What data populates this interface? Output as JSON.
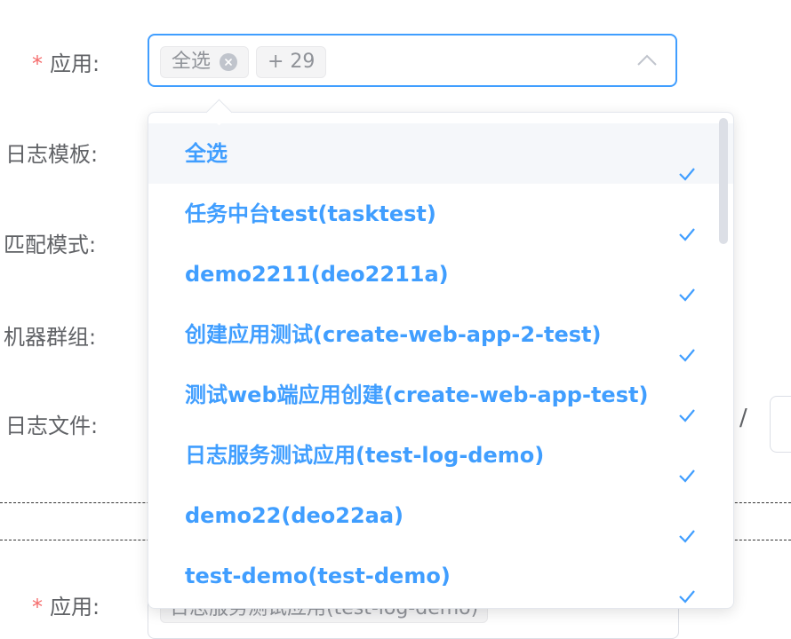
{
  "form": {
    "required_mark": "*",
    "labels": {
      "app": "应用:",
      "log_template": "日志模板:",
      "match_mode": "匹配模式:",
      "machine_group": "机器群组:",
      "log_file": "日志文件:",
      "app2": "应用:"
    },
    "path_separator": "/"
  },
  "app_select": {
    "tags": [
      "全选",
      "+ 29"
    ],
    "icons": {
      "tag_close": "close-circle-icon",
      "arrow": "chevron-up-icon"
    }
  },
  "dropdown": {
    "items": [
      "全选",
      "任务中台test(tasktest)",
      "demo2211(deo2211a)",
      "创建应用测试(create-web-app-2-test)",
      "测试web端应用创建(create-web-app-test)",
      "日志服务测试应用(test-log-demo)",
      "demo22(deo22aa)",
      "test-demo(test-demo)"
    ],
    "check_icon": "check-icon",
    "accent_color": "#409eff"
  },
  "second_select": {
    "tag": "日志服务测试应用(test-log-demo)"
  }
}
